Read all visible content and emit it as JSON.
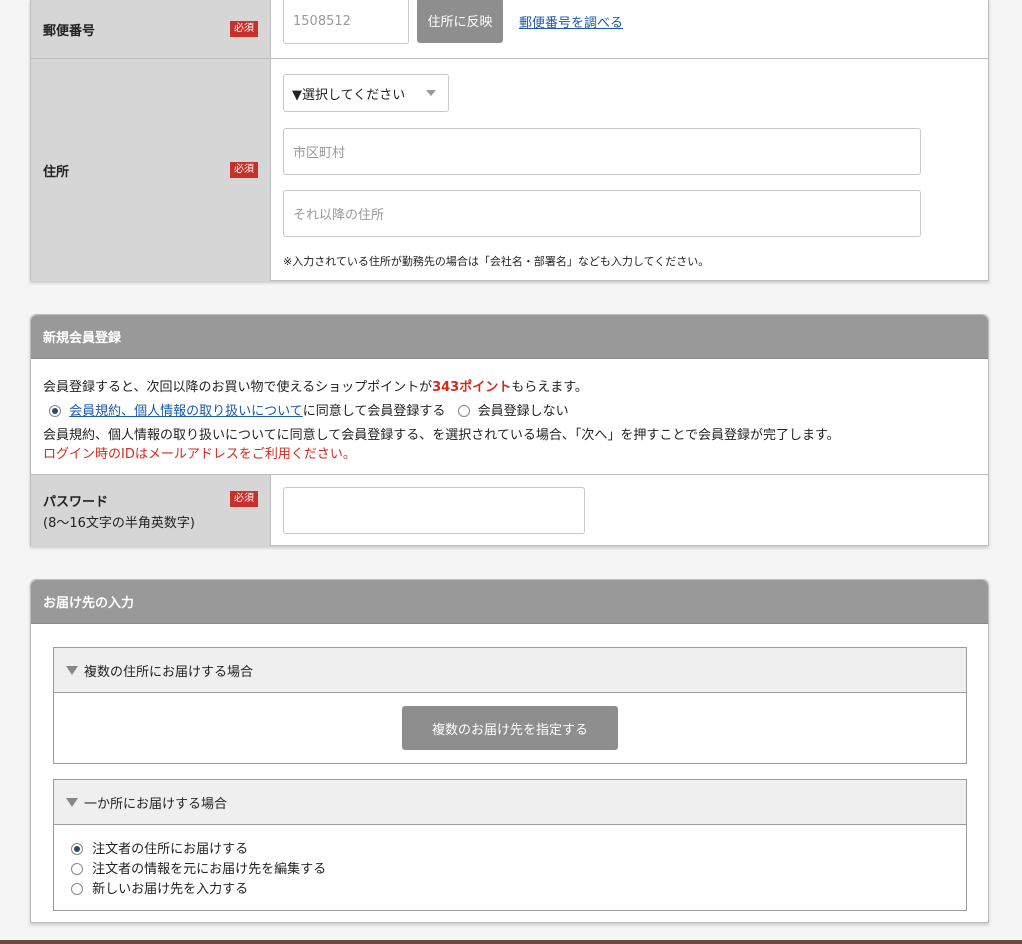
{
  "address": {
    "postal": {
      "label": "郵便番号",
      "required": "必須",
      "value": "1508512",
      "reflect_button": "住所に反映",
      "lookup_link": "郵便番号を調べる"
    },
    "address": {
      "label": "住所",
      "required": "必須",
      "prefecture_select": "▼選択してください",
      "city_placeholder": "市区町村",
      "street_placeholder": "それ以降の住所",
      "note": "※入力されている住所が勤務先の場合は「会社名・部署名」なども入力してください。"
    }
  },
  "registration": {
    "header": "新規会員登録",
    "intro_before": "会員登録すると、次回以降のお買い物で使えるショップポイントが",
    "points": "343ポイント",
    "intro_after": "もらえます。",
    "option_register_link": "会員規約、個人情報の取り扱いについて",
    "option_register_text": "に同意して会員登録する",
    "option_no_register": "会員登録しない",
    "explanation": "会員規約、個人情報の取り扱いについてに同意して会員登録する、を選択されている場合、「次へ」を押すことで会員登録が完了します。",
    "login_note": "ログイン時のIDはメールアドレスをご利用ください。",
    "password_label": "パスワード",
    "password_hint": "(8〜16文字の半角英数字)",
    "required": "必須"
  },
  "delivery": {
    "header": "お届け先の入力",
    "multiple": {
      "title": "複数の住所にお届けする場合",
      "button": "複数のお届け先を指定する"
    },
    "single": {
      "title": "一か所にお届けする場合",
      "options": [
        "注文者の住所にお届けする",
        "注文者の情報を元にお届け先を編集する",
        "新しいお届け先を入力する"
      ]
    }
  },
  "colors": {
    "required_badge": "#c8312b",
    "points_red": "#d12b1f",
    "link_blue": "#1a5aa6",
    "header_gray": "#999999"
  }
}
